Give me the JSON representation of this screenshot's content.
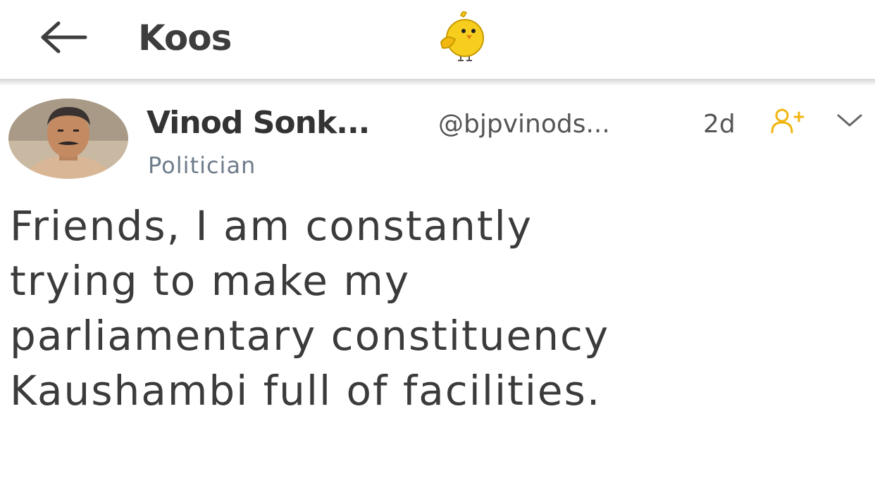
{
  "header": {
    "title": "Koos",
    "back_icon": "arrow-left-icon",
    "logo_icon": "koo-bird-logo"
  },
  "post": {
    "author": {
      "name": "Vinod Sonk...",
      "handle": "@bjpvinods...",
      "title": "Politician",
      "avatar": "profile-photo"
    },
    "time": "2d",
    "follow_icon": "add-user-icon",
    "more_icon": "chevron-down-icon",
    "text_lines": [
      "Friends, I am constantly",
      "trying to make my",
      "parliamentary constituency",
      "Kaushambi full of facilities."
    ]
  },
  "colors": {
    "accent": "#f5c11a",
    "text": "#3b3b3b",
    "muted": "#6f7c8a"
  }
}
